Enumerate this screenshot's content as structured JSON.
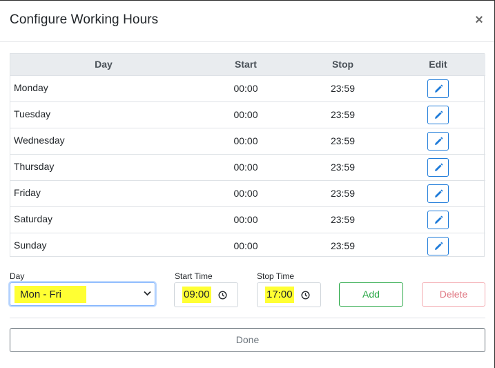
{
  "modal": {
    "title": "Configure Working Hours",
    "close_label": "×"
  },
  "table": {
    "headers": [
      "Day",
      "Start",
      "Stop",
      "Edit"
    ],
    "rows": [
      {
        "day": "Monday",
        "start": "00:00",
        "stop": "23:59"
      },
      {
        "day": "Tuesday",
        "start": "00:00",
        "stop": "23:59"
      },
      {
        "day": "Wednesday",
        "start": "00:00",
        "stop": "23:59"
      },
      {
        "day": "Thursday",
        "start": "00:00",
        "stop": "23:59"
      },
      {
        "day": "Friday",
        "start": "00:00",
        "stop": "23:59"
      },
      {
        "day": "Saturday",
        "start": "00:00",
        "stop": "23:59"
      },
      {
        "day": "Sunday",
        "start": "00:00",
        "stop": "23:59"
      }
    ],
    "edit_icon": "pencil-icon"
  },
  "form": {
    "day_label": "Day",
    "day_value": "Mon - Fri",
    "start_label": "Start Time",
    "start_value": "09:00",
    "stop_label": "Stop Time",
    "stop_value": "17:00",
    "add_label": "Add",
    "delete_label": "Delete",
    "done_label": "Done",
    "clock_icon": "clock-icon",
    "select_icon": "chevron-down-icon"
  },
  "colors": {
    "highlight": "#ffff33",
    "edit_blue": "#1e7bd9",
    "add_green": "#28a745",
    "delete_red": "#e07883",
    "header_bg": "#e9ecef"
  }
}
